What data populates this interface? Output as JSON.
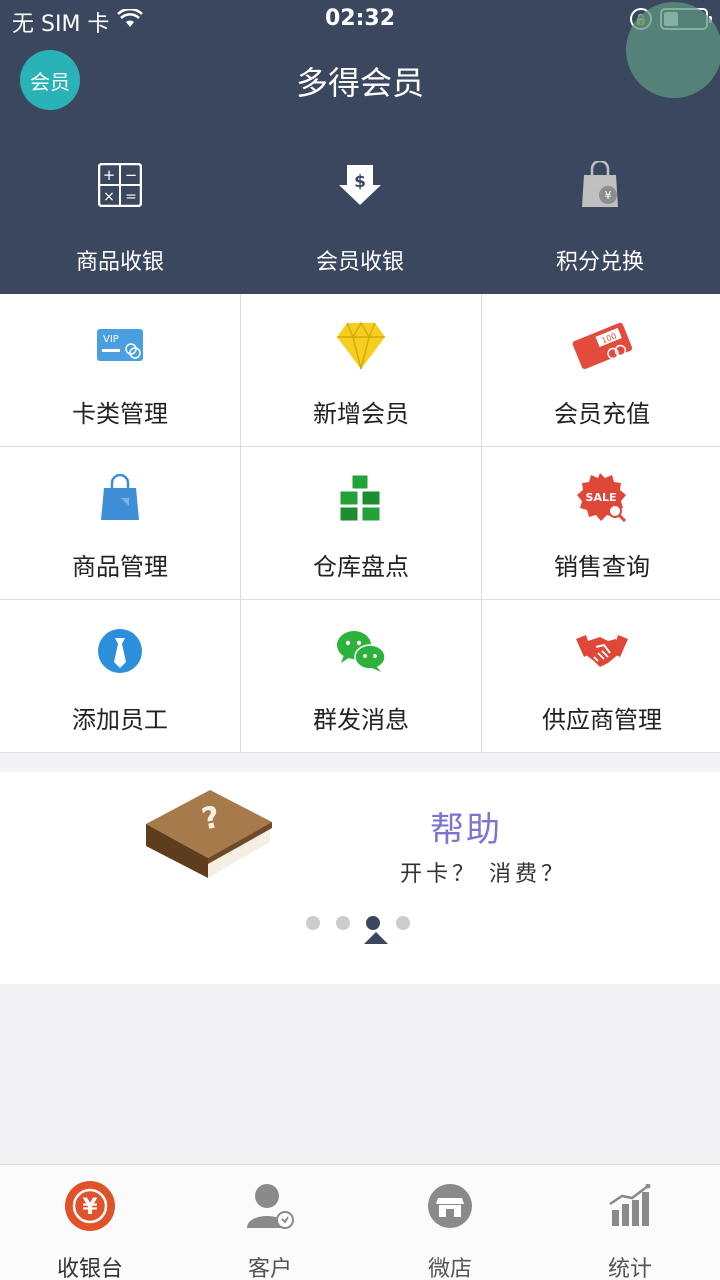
{
  "status_bar": {
    "carrier": "无 SIM 卡",
    "time": "02:32",
    "battery_level": 0.35
  },
  "header": {
    "badge": "会员",
    "title": "多得会员"
  },
  "top_actions": [
    {
      "label": "商品收银",
      "icon": "calculator-icon"
    },
    {
      "label": "会员收银",
      "icon": "dollar-arrow-icon"
    },
    {
      "label": "积分兑换",
      "icon": "shopping-bag-yen-icon"
    }
  ],
  "grid": [
    {
      "label": "卡类管理",
      "icon": "vip-card-icon"
    },
    {
      "label": "新增会员",
      "icon": "diamond-icon"
    },
    {
      "label": "会员充值",
      "icon": "money-ticket-icon"
    },
    {
      "label": "商品管理",
      "icon": "shopping-bag-icon"
    },
    {
      "label": "仓库盘点",
      "icon": "boxes-icon"
    },
    {
      "label": "销售查询",
      "icon": "sale-search-icon"
    },
    {
      "label": "添加员工",
      "icon": "employee-tie-icon"
    },
    {
      "label": "群发消息",
      "icon": "wechat-icon"
    },
    {
      "label": "供应商管理",
      "icon": "handshake-icon"
    }
  ],
  "banner": {
    "title": "帮助",
    "subtitle": "开卡？ 消费？",
    "page_count": 4,
    "active_page": 3
  },
  "tabs": [
    {
      "label": "收银台",
      "icon": "cashier-yen-icon",
      "active": true
    },
    {
      "label": "客户",
      "icon": "customer-icon",
      "active": false
    },
    {
      "label": "微店",
      "icon": "shop-icon",
      "active": false
    },
    {
      "label": "统计",
      "icon": "stats-chart-icon",
      "active": false
    }
  ],
  "colors": {
    "header_bg": "#3a475f",
    "badge": "#2ab3b6",
    "help_title": "#7b74d2",
    "tab_active": "#e0532a"
  }
}
